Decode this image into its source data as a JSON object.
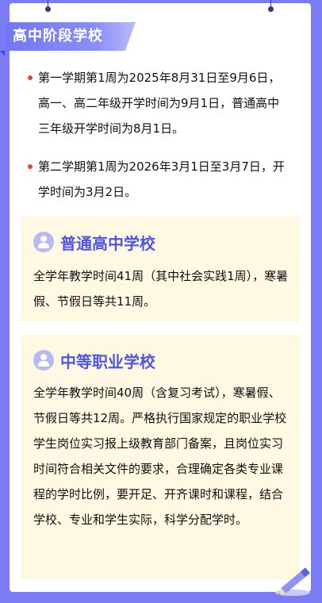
{
  "header": {
    "title": "高中阶段学校"
  },
  "bullets": [
    {
      "text": "第一学期第1周为2025年8月31日至9月6日，高一、高二年级开学时间为9月1日，普通高中三年级开学时间为8月1日。"
    },
    {
      "text": "第二学期第1周为2026年3月1日至3月7日，开学时间为3月2日。"
    }
  ],
  "boxes": [
    {
      "title": "普通高中学校",
      "text": "全学年教学时间41周（其中社会实践1周），寒暑假、节假日等共11周。"
    },
    {
      "title": "中等职业学校",
      "text": "全学年教学时间40周（含复习考试），寒暑假、节假日等共12周。严格执行国家规定的职业学校学生岗位实习报上级教育部门备案，且岗位实习时间符合相关文件的要求，合理确定各类专业课程的学时比例，要开足、开齐课时和课程，结合学校、专业和学生实际，科学分配学时。"
    }
  ],
  "colors": {
    "background": "#7B7CF5",
    "accent": "#4F55E6",
    "bullet_dot": "#E2453C",
    "box_bg": "#FFF8E2"
  },
  "icons": [
    "pin-icon",
    "person-icon",
    "pencil-icon"
  ]
}
